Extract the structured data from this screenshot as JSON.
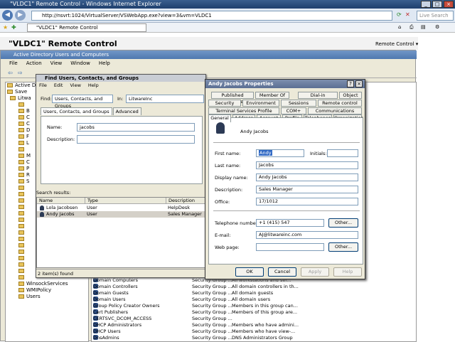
{
  "browser": {
    "window_title": "\"VLDC1\" Remote Control - Windows Internet Explorer",
    "url": "http://nsvrt:1024/VirtualServer/VSWebApp.exe?view=3&vm=VLDC1",
    "search_placeholder": "Live Search",
    "tab_label": "\"VLDC1\" Remote Control"
  },
  "page": {
    "title": "\"VLDC1\" Remote Control",
    "remote_control_menu": "Remote Control"
  },
  "mmc": {
    "title": "Active Directory Users and Computers",
    "menu": [
      "File",
      "Action",
      "View",
      "Window",
      "Help"
    ],
    "tree": [
      "Active Di",
      "Save",
      "Litwa",
      "",
      "B",
      "C",
      "C",
      "D",
      "F",
      "L",
      "",
      "M",
      "C",
      "P",
      "R",
      "S",
      "",
      "",
      "",
      "",
      "",
      "",
      "",
      "",
      "",
      "",
      "",
      "",
      "",
      "",
      "",
      "WinsockServices",
      "WMIPolicy",
      "Users"
    ],
    "groups": [
      {
        "name": "Domain Computers",
        "type": "Security Group ...",
        "desc": "All workstations and ser..."
      },
      {
        "name": "Domain Controllers",
        "type": "Security Group ...",
        "desc": "All domain controllers in th..."
      },
      {
        "name": "Domain Guests",
        "type": "Security Group ...",
        "desc": "All domain guests"
      },
      {
        "name": "Domain Users",
        "type": "Security Group ...",
        "desc": "All domain users"
      },
      {
        "name": "Group Policy Creator Owners",
        "type": "Security Group ...",
        "desc": "Members in this group can..."
      },
      {
        "name": "Cert Publishers",
        "type": "Security Group ...",
        "desc": "Members of this group are..."
      },
      {
        "name": "CERTSVC_DCOM_ACCESS",
        "type": "Security Group ...",
        "desc": ""
      },
      {
        "name": "DHCP Administrators",
        "type": "Security Group ...",
        "desc": "Members who have admini..."
      },
      {
        "name": "DHCP Users",
        "type": "Security Group ...",
        "desc": "Members who have view-..."
      },
      {
        "name": "DnsAdmins",
        "type": "Security Group ...",
        "desc": "DNS Administrators Group"
      }
    ]
  },
  "find": {
    "title": "Find Users, Contacts, and Groups",
    "menu": [
      "File",
      "Edit",
      "View",
      "Help"
    ],
    "find_label": "Find:",
    "find_value": "Users, Contacts, and Groups",
    "in_label": "In:",
    "in_value": "LitwareInc",
    "tabs": [
      "Users, Contacts, and Groups",
      "Advanced"
    ],
    "name_label": "Name:",
    "name_value": "jacobs",
    "description_label": "Description:",
    "description_value": "",
    "results_label": "Search results:",
    "columns": [
      "Name",
      "Type",
      "Description"
    ],
    "rows": [
      {
        "name": "Lola Jacobsen",
        "type": "User",
        "desc": "HelpDesk Technician"
      },
      {
        "name": "Andy Jacobs",
        "type": "User",
        "desc": "Sales Manager"
      }
    ],
    "status": "2 item(s) found"
  },
  "props": {
    "title": "Andy Jacobs Properties",
    "tabs_row1": [
      "Published Certificates",
      "Member Of",
      "Dial-in",
      "Object"
    ],
    "tabs_row2": [
      "Security",
      "Environment",
      "Sessions",
      "Remote control"
    ],
    "tabs_row3": [
      "Terminal Services Profile",
      "COM+",
      "Communications"
    ],
    "tabs_row4": [
      "General",
      "Address",
      "Account",
      "Profile",
      "Telephones",
      "Organization"
    ],
    "display_heading": "Andy Jacobs",
    "first_name_label": "First name:",
    "first_name": "Andy",
    "initials_label": "Initials:",
    "initials": "",
    "last_name_label": "Last name:",
    "last_name": "Jacobs",
    "display_name_label": "Display name:",
    "display_name": "Andy Jacobs",
    "description_label": "Description:",
    "description": "Sales Manager",
    "office_label": "Office:",
    "office": "17/1012",
    "telephone_label": "Telephone number:",
    "telephone": "+1 (415) 547",
    "email_label": "E-mail:",
    "email": "AJ@litwareinc.com",
    "webpage_label": "Web page:",
    "webpage": "",
    "other_label": "Other...",
    "ok": "OK",
    "cancel": "Cancel",
    "apply": "Apply",
    "help": "Help"
  }
}
